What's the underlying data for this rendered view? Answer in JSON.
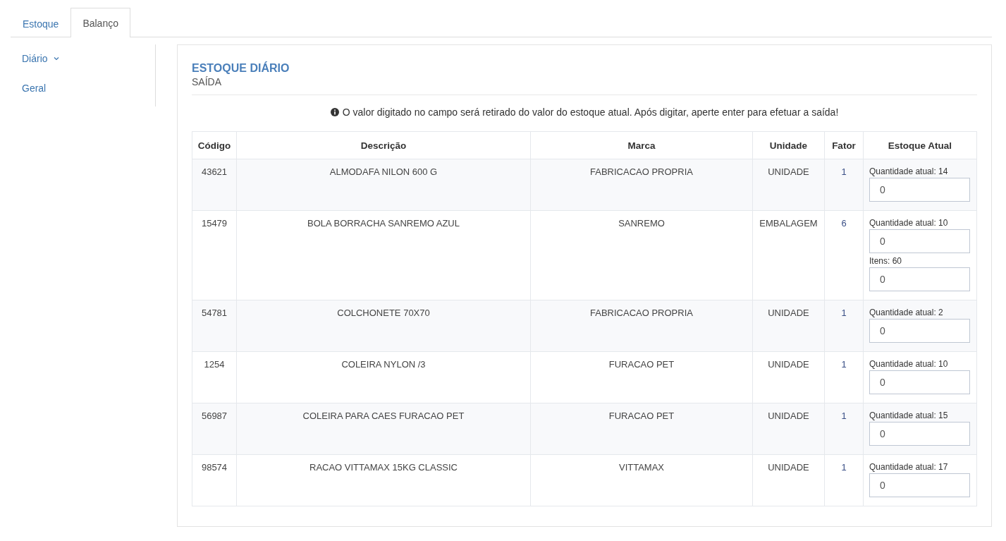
{
  "tabs": [
    {
      "label": "Estoque",
      "selected": false
    },
    {
      "label": "Balanço",
      "selected": true
    }
  ],
  "sidebar": {
    "items": [
      {
        "label": "Diário",
        "expandable": true
      },
      {
        "label": "Geral",
        "expandable": false
      }
    ]
  },
  "panel": {
    "title": "ESTOQUE DIÁRIO",
    "subtitle": "SAÍDA",
    "notice": "O valor digitado no campo será retirado do valor do estoque atual. Após digitar, aperte enter para efetuar a saída!"
  },
  "table": {
    "columns": [
      "Código",
      "Descrição",
      "Marca",
      "Unidade",
      "Fator",
      "Estoque Atual"
    ],
    "rows": [
      {
        "codigo": "43621",
        "descricao": "ALMODAFA NILON 600 G",
        "marca": "FABRICACAO PROPRIA",
        "unidade": "UNIDADE",
        "fator": "1",
        "stock": [
          {
            "label": "Quantidade atual: 14",
            "value": "0"
          }
        ]
      },
      {
        "codigo": "15479",
        "descricao": "BOLA BORRACHA SANREMO AZUL",
        "marca": "SANREMO",
        "unidade": "EMBALAGEM",
        "fator": "6",
        "stock": [
          {
            "label": "Quantidade atual: 10",
            "value": "0"
          },
          {
            "label": "Itens: 60",
            "value": "0"
          }
        ]
      },
      {
        "codigo": "54781",
        "descricao": "COLCHONETE 70X70",
        "marca": "FABRICACAO PROPRIA",
        "unidade": "UNIDADE",
        "fator": "1",
        "stock": [
          {
            "label": "Quantidade atual: 2",
            "value": "0"
          }
        ]
      },
      {
        "codigo": "1254",
        "descricao": "COLEIRA NYLON /3",
        "marca": "FURACAO PET",
        "unidade": "UNIDADE",
        "fator": "1",
        "stock": [
          {
            "label": "Quantidade atual: 10",
            "value": "0"
          }
        ]
      },
      {
        "codigo": "56987",
        "descricao": "COLEIRA PARA CAES FURACAO PET",
        "marca": "FURACAO PET",
        "unidade": "UNIDADE",
        "fator": "1",
        "stock": [
          {
            "label": "Quantidade atual: 15",
            "value": "0"
          }
        ]
      },
      {
        "codigo": "98574",
        "descricao": "RACAO VITTAMAX 15KG CLASSIC",
        "marca": "VITTAMAX",
        "unidade": "UNIDADE",
        "fator": "1",
        "stock": [
          {
            "label": "Quantidade atual: 17",
            "value": "0"
          }
        ]
      }
    ]
  }
}
